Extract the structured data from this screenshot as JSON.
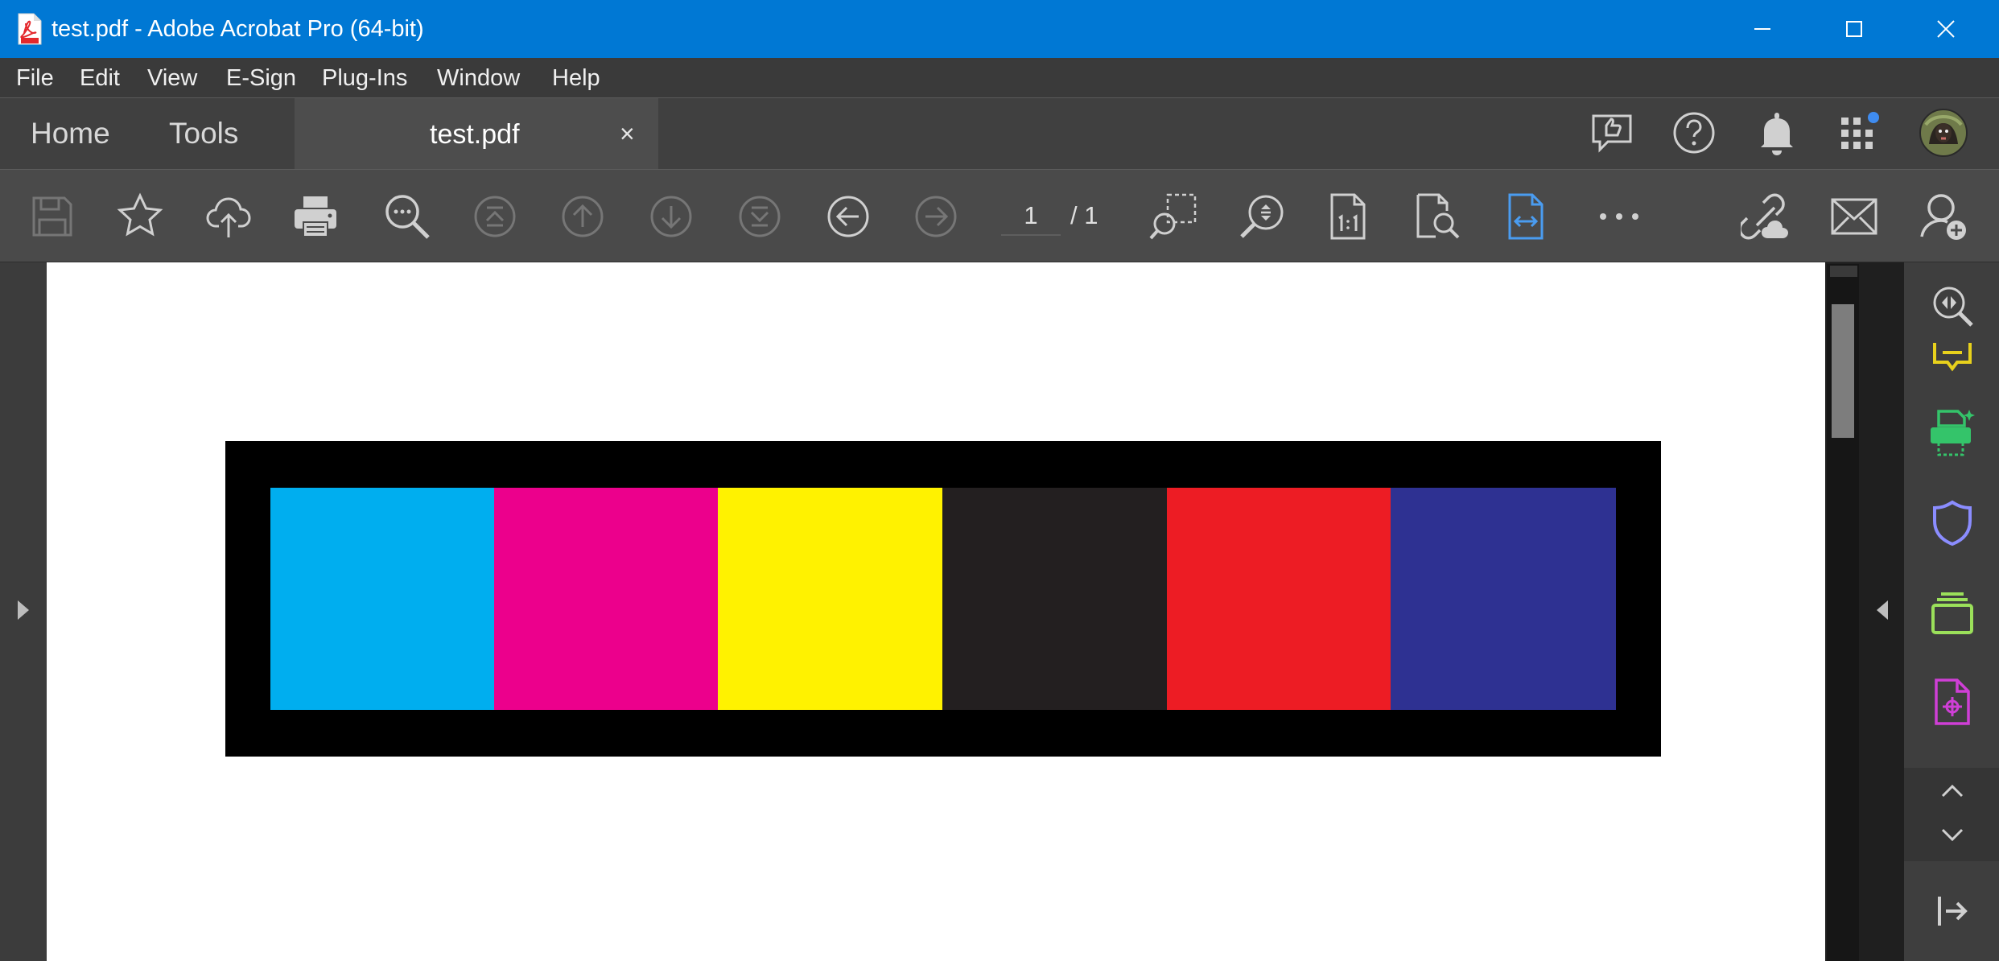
{
  "window": {
    "title": "test.pdf - Adobe Acrobat Pro (64-bit)",
    "controls": [
      "minimize-icon",
      "maximize-icon",
      "close-icon"
    ]
  },
  "menu": {
    "items": [
      {
        "label": "File"
      },
      {
        "label": "Edit"
      },
      {
        "label": "View"
      },
      {
        "label": "E-Sign"
      },
      {
        "label": "Plug-Ins"
      },
      {
        "label": "Window"
      },
      {
        "label": "Help"
      }
    ]
  },
  "tabs": {
    "home": "Home",
    "tools": "Tools",
    "document": "test.pdf",
    "close_glyph": "×"
  },
  "header_icons": [
    "share-feedback-icon",
    "help-icon",
    "notifications-icon",
    "apps-grid-icon",
    "user-avatar"
  ],
  "toolbar": {
    "icons": [
      "save-icon",
      "bookmark-star-icon",
      "cloud-upload-icon",
      "print-icon",
      "find-text-icon",
      "first-page-icon",
      "previous-page-icon",
      "next-page-icon",
      "last-page-icon",
      "previous-view-icon",
      "next-view-icon"
    ],
    "page_current": "1",
    "page_total": "/ 1",
    "view_icons": [
      "marquee-zoom-icon",
      "zoom-icon",
      "actual-size-icon",
      "fit-page-zoom-icon",
      "fit-width-icon",
      "more-tools-icon",
      "share-link-icon",
      "email-icon",
      "add-user-icon"
    ]
  },
  "document": {
    "swatches": [
      {
        "name": "cyan",
        "color": "#00aeef"
      },
      {
        "name": "magenta",
        "color": "#ec008c"
      },
      {
        "name": "yellow",
        "color": "#fff200"
      },
      {
        "name": "black",
        "color": "#231f20"
      },
      {
        "name": "red",
        "color": "#ed1c24"
      },
      {
        "name": "blue",
        "color": "#2e3192"
      }
    ],
    "frame_color": "#000000"
  },
  "right_panel": {
    "icons": [
      "search-zoom-icon",
      "comment-icon",
      "print-production-icon",
      "protect-shield-icon",
      "organize-pages-icon",
      "edit-pdf-icon"
    ],
    "nav": [
      "scroll-up-icon",
      "scroll-down-icon"
    ],
    "collapse": "collapse-panel-icon"
  },
  "accents": {
    "titlebar": "#0078d4",
    "active_tool": "#4a9cf0",
    "comment": "#e8d11c",
    "print_production": "#34c46a",
    "protect": "#8b8dff",
    "organize": "#9be05a",
    "edit": "#cf3fd6"
  }
}
